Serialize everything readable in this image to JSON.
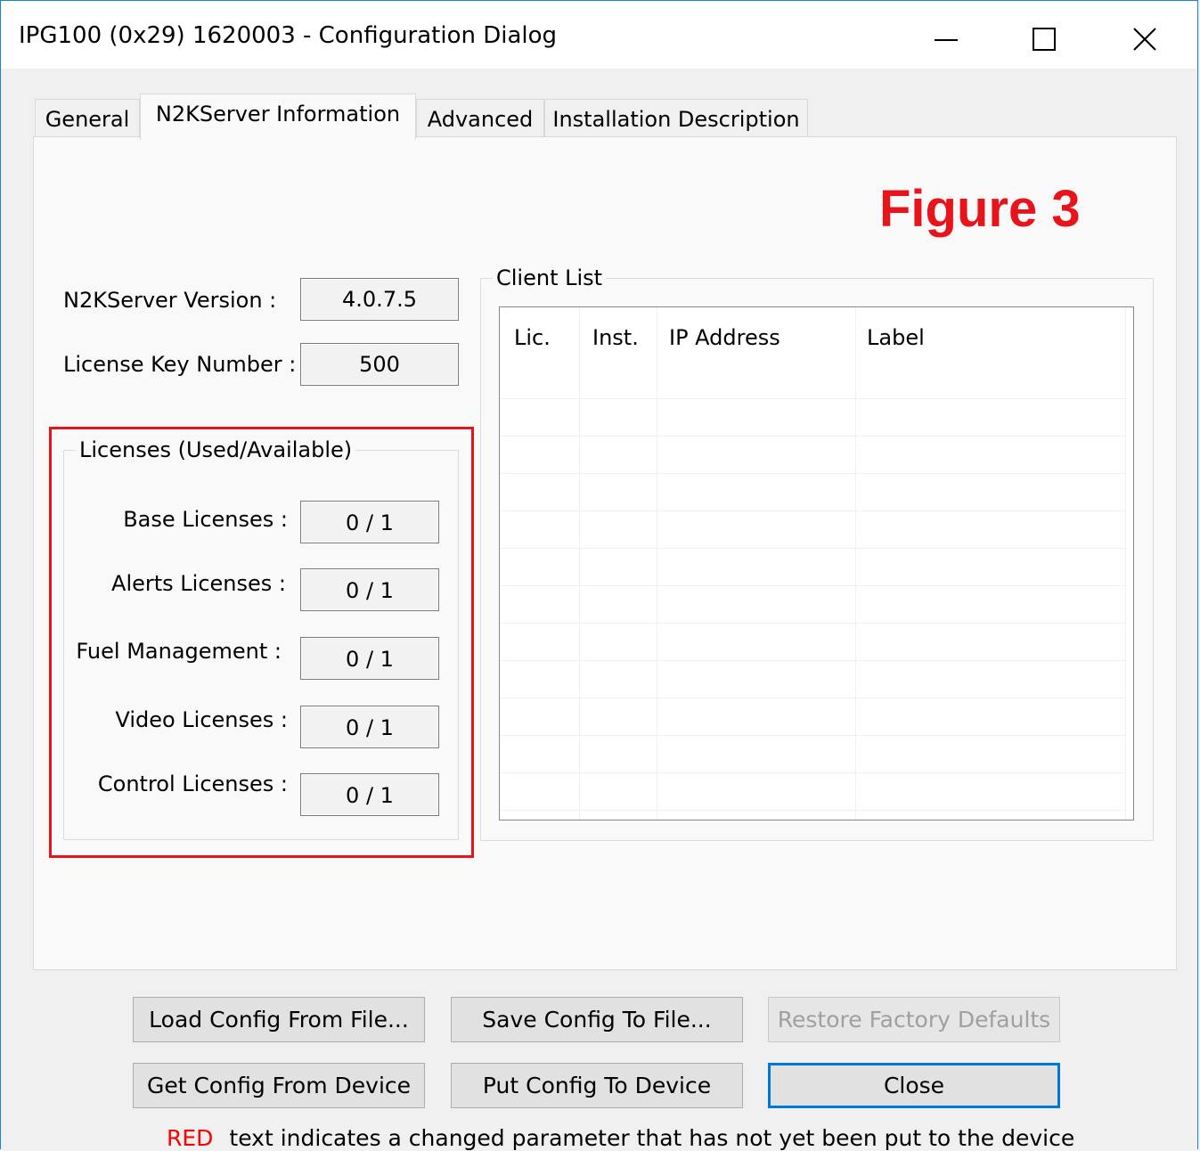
{
  "window": {
    "title": "IPG100 (0x29) 1620003 - Configuration Dialog"
  },
  "tabs": [
    {
      "label": "General"
    },
    {
      "label": "N2KServer Information"
    },
    {
      "label": "Advanced"
    },
    {
      "label": "Installation Description"
    }
  ],
  "annotation": "Figure 3",
  "server": {
    "version_label": "N2KServer Version :",
    "version_value": "4.0.7.5",
    "license_key_label": "License Key Number :",
    "license_key_value": "500"
  },
  "licenses": {
    "group_title": "Licenses (Used/Available)",
    "items": [
      {
        "label": "Base Licenses :",
        "value": "0 / 1"
      },
      {
        "label": "Alerts Licenses :",
        "value": "0 / 1"
      },
      {
        "label": "Fuel Management :",
        "value": "0 / 1"
      },
      {
        "label": "Video Licenses :",
        "value": "0 / 1"
      },
      {
        "label": "Control Licenses :",
        "value": "0 / 1"
      }
    ]
  },
  "client_list": {
    "group_title": "Client List",
    "columns": [
      "Lic.",
      "Inst.",
      "IP Address",
      "Label"
    ]
  },
  "buttons": {
    "load": "Load Config From File...",
    "save": "Save Config To File...",
    "restore": "Restore Factory Defaults",
    "get": "Get Config From Device",
    "put": "Put Config To Device",
    "close": "Close"
  },
  "status": {
    "red_word": "RED",
    "message": "text indicates a changed parameter that has not yet been put to the device"
  },
  "colors": {
    "annotation": "#e8141c",
    "highlight_box": "#e5141b",
    "default_button_border": "#0078d7"
  }
}
